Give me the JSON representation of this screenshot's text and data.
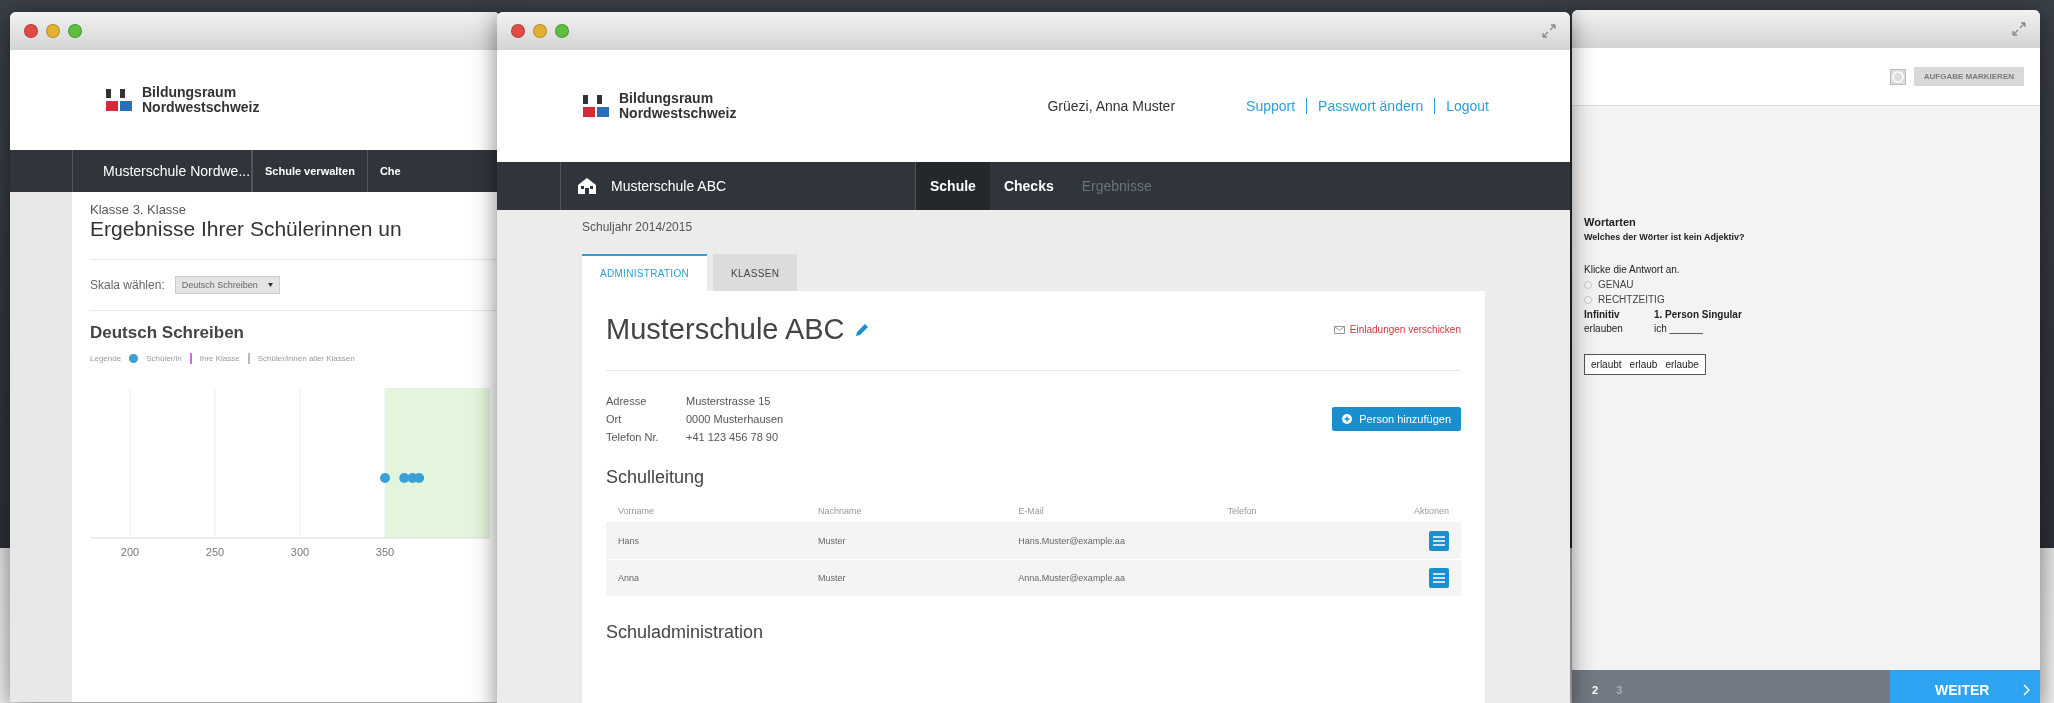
{
  "left_window": {
    "logo": {
      "line1": "Bildungsraum",
      "line2": "Nordwestschweiz"
    },
    "nav": {
      "school": "Musterschule Nordwe...",
      "items": [
        "Schule verwalten",
        "Che"
      ]
    },
    "class_label": "Klasse 3. Klasse",
    "heading": "Ergebnisse Ihrer Schülerinnen un",
    "scale_label": "Skala wählen:",
    "scale_select": "Deutsch Schreiben",
    "chart_title": "Deutsch Schreiben",
    "legend": {
      "label": "Legende",
      "items": [
        {
          "kind": "dot",
          "label": "Schüler/in",
          "color": "#3aa0d8"
        },
        {
          "kind": "bar",
          "label": "Ihre Klasse",
          "color": "#c070e0"
        },
        {
          "kind": "bar",
          "label": "Schüler/innen aller Klassen",
          "color": "#bbbbbb"
        }
      ]
    },
    "chart_axis_labels": [
      "200",
      "250",
      "300",
      "350"
    ]
  },
  "main_window": {
    "logo": {
      "line1": "Bildungsraum",
      "line2": "Nordwestschweiz"
    },
    "greeting": "Grüezi, Anna Muster",
    "links": [
      "Support",
      "Passwort ändern",
      "Logout"
    ],
    "nav": {
      "school": "Musterschule ABC",
      "items": [
        {
          "label": "Schule",
          "selected": true,
          "disabled": false
        },
        {
          "label": "Checks",
          "selected": false,
          "disabled": false
        },
        {
          "label": "Ergebnisse",
          "selected": false,
          "disabled": true
        }
      ]
    },
    "school_year": "Schuljahr 2014/2015",
    "tabs": [
      {
        "label": "ADMINISTRATION",
        "selected": true
      },
      {
        "label": "KLASSEN",
        "selected": false
      }
    ],
    "card": {
      "title": "Musterschule ABC",
      "invite_link": "Einladungen verschicken",
      "details": [
        {
          "label": "Adresse",
          "value": "Musterstrasse 15"
        },
        {
          "label": "Ort",
          "value": "0000 Musterhausen"
        },
        {
          "label": "Telefon Nr.",
          "value": "+41 123 456 78 90"
        }
      ],
      "add_button": "Person hinzufügen",
      "sections": [
        {
          "title": "Schulleitung",
          "columns": [
            "Vorname",
            "Nachname",
            "E-Mail",
            "Telefon",
            "Aktionen"
          ],
          "rows": [
            [
              "Hans",
              "Muster",
              "Hans.Muster@example.aa",
              ""
            ],
            [
              "Anna",
              "Muster",
              "Anna.Muster@example.aa",
              ""
            ]
          ]
        },
        {
          "title": "Schuladministration"
        }
      ]
    }
  },
  "right_window": {
    "flag_button": "AUFGABE MARKIEREN",
    "topic": "Wortarten",
    "question": "Welches der Wörter ist kein Adjektiv?",
    "instruction": "Klicke die Antwort an.",
    "options": [
      {
        "label": "GENAU",
        "selected": false
      },
      {
        "label": "RECHTZEITIG",
        "selected": false
      }
    ],
    "table": {
      "columns": [
        "Infinitiv",
        "1. Person Singular"
      ],
      "row": [
        "erlauben",
        "ich ______"
      ]
    },
    "choices": [
      "erlaubt",
      "erlaub",
      "erlaube"
    ],
    "pages": [
      {
        "label": "2",
        "selected": true
      },
      {
        "label": "3",
        "selected": false
      }
    ],
    "next_button": "WEITER"
  }
}
